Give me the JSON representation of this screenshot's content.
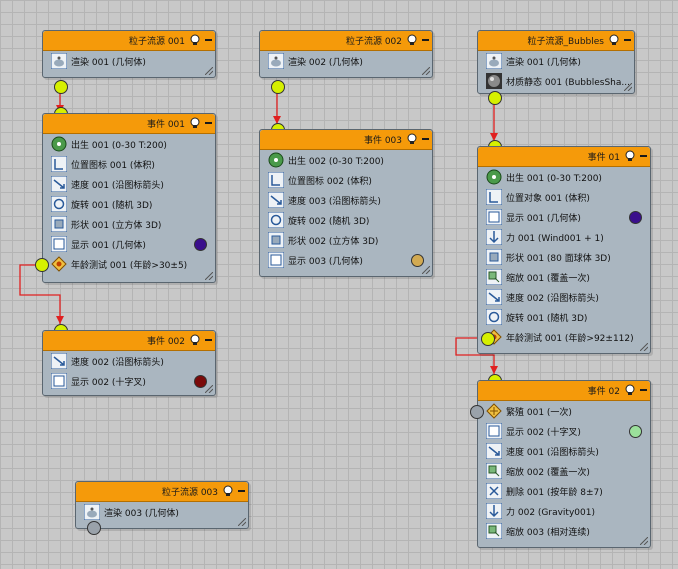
{
  "bulb_icon": "lightbulb-icon",
  "collapse_icon": "minus-icon",
  "n1": {
    "title": "粒子流源 001",
    "rows": [
      "渲染 001 (几何体)"
    ]
  },
  "n2": {
    "title": "粒子流源 002",
    "rows": [
      "渲染 002 (几何体)"
    ]
  },
  "n3": {
    "title": "粒子流源_Bubbles",
    "rows": [
      "渲染 001 (几何体)",
      "材质静态 001 (BubblesSha..."
    ]
  },
  "e1": {
    "title": "事件 001",
    "rows": [
      "出生 001 (0-30 T:200)",
      "位置图标 001 (体积)",
      "速度 001 (沿图标箭头)",
      "旋转 001 (随机 3D)",
      "形状 001 (立方体 3D)",
      "显示 001 (几何体)",
      "年龄测试 001 (年龄>30±5)"
    ]
  },
  "e3": {
    "title": "事件 003",
    "rows": [
      "出生 002 (0-30 T:200)",
      "位置图标 002 (体积)",
      "速度 003 (沿图标箭头)",
      "旋转 002 (随机 3D)",
      "形状 002 (立方体 3D)",
      "显示 003 (几何体)"
    ]
  },
  "e01": {
    "title": "事件 01",
    "rows": [
      "出生 001 (0-30 T:200)",
      "位置对象 001 (体积)",
      "显示 001 (几何体)",
      "力 001 (Wind001 + 1)",
      "形状 001 (80 面球体 3D)",
      "缩放 001 (覆盖一次)",
      "速度 002 (沿图标箭头)",
      "旋转 001 (随机 3D)",
      "年龄测试 001 (年龄>92±112)"
    ]
  },
  "e2": {
    "title": "事件 002",
    "rows": [
      "速度 002 (沿图标箭头)",
      "显示 002 (十字叉)"
    ]
  },
  "e02": {
    "title": "事件 02",
    "rows": [
      "繁殖 001 (一次)",
      "显示 002 (十字叉)",
      "速度 001 (沿图标箭头)",
      "缩放 002 (覆盖一次)",
      "删除 001 (按年龄 8±7)",
      "力 002 (Gravity001)",
      "缩放 003 (相对连续)"
    ]
  },
  "n4": {
    "title": "粒子流源 003",
    "rows": [
      "渲染 003 (几何体)"
    ]
  },
  "colors": {
    "purple": "#3a0f8c",
    "darkred": "#7a0a0a",
    "tan": "#d2aa52",
    "green": "#9be09b",
    "header": "#f59a0a",
    "wire": "#e02020"
  }
}
